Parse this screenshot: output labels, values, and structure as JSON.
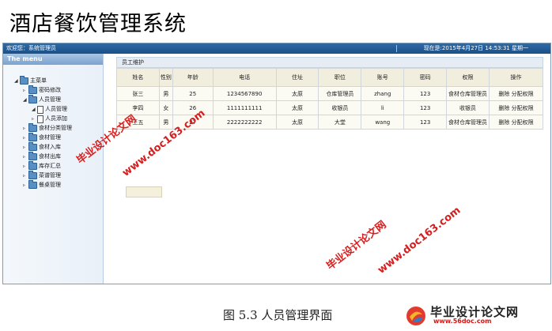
{
  "doc_title": "酒店餐饮管理系统",
  "topbar": {
    "welcome": "欢迎您：系统管理员",
    "clock": "现在是:2015年4月27日 14:53:31 星期一"
  },
  "sidebar": {
    "header": "The menu",
    "root": "主菜单",
    "items": [
      {
        "label": "密码修改"
      },
      {
        "label": "人员管理"
      },
      {
        "label": "人员管理"
      },
      {
        "label": "人员添加"
      },
      {
        "label": "食材分类管理"
      },
      {
        "label": "食材管理"
      },
      {
        "label": "食材入库"
      },
      {
        "label": "食材出库"
      },
      {
        "label": "库存汇总"
      },
      {
        "label": "菜谱管理"
      },
      {
        "label": "餐桌管理"
      }
    ]
  },
  "panel": {
    "title": "员工维护"
  },
  "table": {
    "headers": [
      "姓名",
      "性别",
      "年龄",
      "电话",
      "住址",
      "职位",
      "账号",
      "密码",
      "权限",
      "操作"
    ],
    "rows": [
      [
        "张三",
        "男",
        "25",
        "1234567890",
        "太原",
        "仓库管理员",
        "zhang",
        "123",
        "食材仓库管理员"
      ],
      [
        "李四",
        "女",
        "26",
        "1111111111",
        "太原",
        "收银员",
        "li",
        "123",
        "收银员"
      ],
      [
        "王五",
        "男",
        "27",
        "2222222222",
        "太原",
        "大堂",
        "wang",
        "123",
        "食材仓库管理员"
      ]
    ],
    "op_delete": "删除",
    "op_assign": "分配权限"
  },
  "caption": "图 5.3  人员管理界面",
  "watermark": {
    "text1": "毕业设计论文网",
    "text2": "www.doc163.com"
  },
  "logo": {
    "name": "毕业设计论文网",
    "url": "www.56doc.com"
  },
  "colors": {
    "topbar": "#1b4f88",
    "header_row": "#f2eedd",
    "watermark": "#d71e1e"
  }
}
